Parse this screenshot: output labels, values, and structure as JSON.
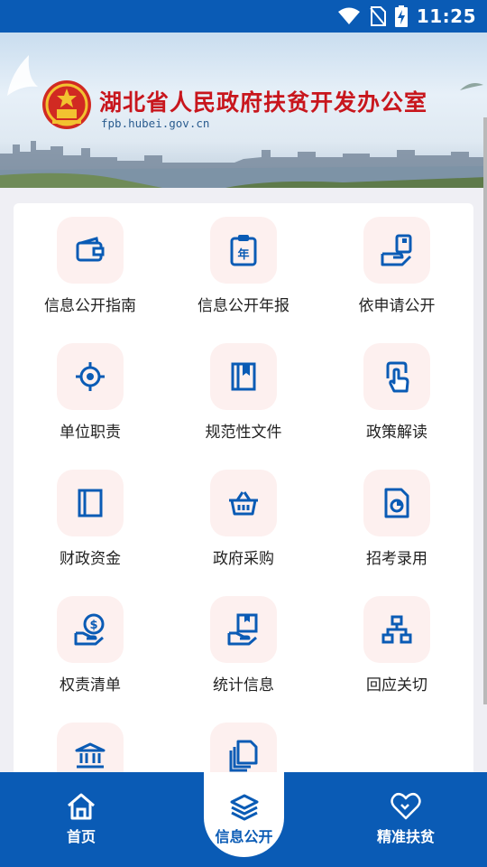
{
  "status_bar": {
    "time": "11:25"
  },
  "banner": {
    "title": "湖北省人民政府扶贫开发办公室",
    "url": "fpb.hubei.gov.cn"
  },
  "grid": [
    {
      "label": "信息公开指南",
      "icon": "wallet-icon"
    },
    {
      "label": "信息公开年报",
      "icon": "annual-report-icon"
    },
    {
      "label": "依申请公开",
      "icon": "apply-icon"
    },
    {
      "label": "单位职责",
      "icon": "target-icon"
    },
    {
      "label": "规范性文件",
      "icon": "book-icon"
    },
    {
      "label": "政策解读",
      "icon": "touch-icon"
    },
    {
      "label": "财政资金",
      "icon": "notebook-icon"
    },
    {
      "label": "政府采购",
      "icon": "basket-icon"
    },
    {
      "label": "招考录用",
      "icon": "pie-doc-icon"
    },
    {
      "label": "权责清单",
      "icon": "money-hand-icon"
    },
    {
      "label": "统计信息",
      "icon": "box-hand-icon"
    },
    {
      "label": "回应关切",
      "icon": "org-chart-icon"
    },
    {
      "label": "",
      "icon": "bank-icon"
    },
    {
      "label": "",
      "icon": "copy-doc-icon"
    }
  ],
  "bottom_nav": {
    "home": "首页",
    "info": "信息公开",
    "poverty": "精准扶贫"
  },
  "colors": {
    "brand_blue": "#0a5bb5",
    "title_red": "#c8161d",
    "icon_bg": "#fdf0ef"
  }
}
